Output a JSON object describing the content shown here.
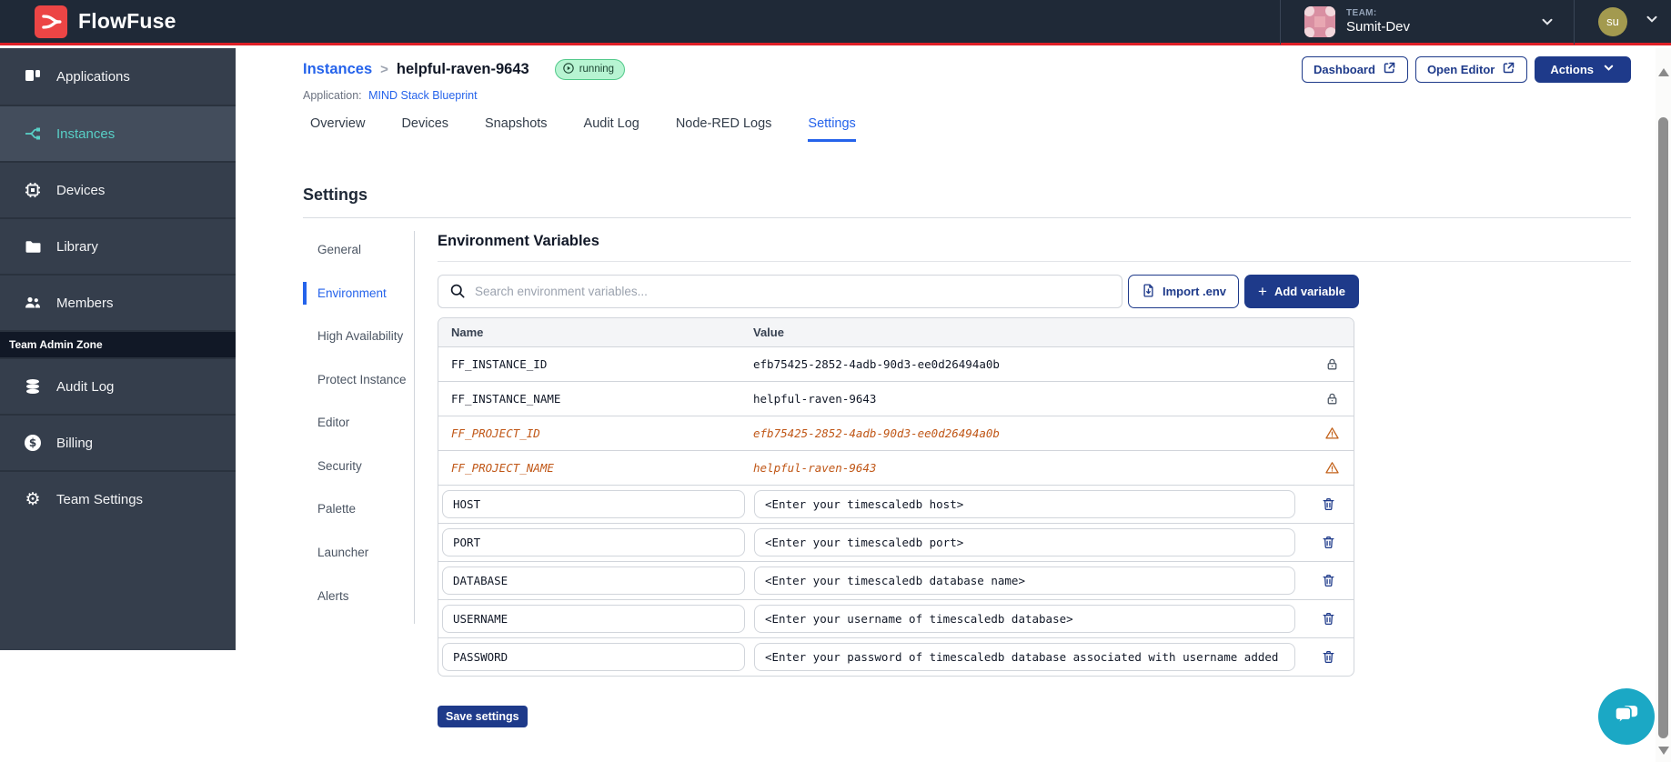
{
  "topbar": {
    "brand": "FlowFuse",
    "team": {
      "label": "TEAM:",
      "name": "Sumit-Dev"
    },
    "user": {
      "initials": "su"
    }
  },
  "sidebar": {
    "items": [
      {
        "label": "Applications"
      },
      {
        "label": "Instances"
      },
      {
        "label": "Devices"
      },
      {
        "label": "Library"
      },
      {
        "label": "Members"
      }
    ],
    "section_label": "Team Admin Zone",
    "admin_items": [
      {
        "label": "Audit Log"
      },
      {
        "label": "Billing"
      },
      {
        "label": "Team Settings"
      }
    ]
  },
  "header": {
    "breadcrumb": {
      "parent": "Instances",
      "separator": ">",
      "current": "helpful-raven-9643"
    },
    "status_badge": "running",
    "application": {
      "label": "Application:",
      "name": "MIND Stack Blueprint"
    },
    "buttons": {
      "dashboard": "Dashboard",
      "open_editor": "Open Editor",
      "actions": "Actions"
    }
  },
  "tabs": {
    "items": [
      {
        "label": "Overview"
      },
      {
        "label": "Devices"
      },
      {
        "label": "Snapshots"
      },
      {
        "label": "Audit Log"
      },
      {
        "label": "Node-RED Logs"
      },
      {
        "label": "Settings"
      }
    ],
    "active": "Settings"
  },
  "settings": {
    "title": "Settings",
    "nav": {
      "items": [
        {
          "label": "General"
        },
        {
          "label": "Environment"
        },
        {
          "label": "High Availability"
        },
        {
          "label": "Protect Instance"
        },
        {
          "label": "Editor"
        },
        {
          "label": "Security"
        },
        {
          "label": "Palette"
        },
        {
          "label": "Launcher"
        },
        {
          "label": "Alerts"
        }
      ],
      "active": "Environment"
    }
  },
  "environment": {
    "title": "Environment Variables",
    "search_placeholder": "Search environment variables...",
    "import_button": "Import .env",
    "add_button": "Add variable",
    "table": {
      "columns": {
        "name": "Name",
        "value": "Value"
      },
      "locked_rows": [
        {
          "name": "FF_INSTANCE_ID",
          "value": "efb75425-2852-4adb-90d3-ee0d26494a0b",
          "state": "locked"
        },
        {
          "name": "FF_INSTANCE_NAME",
          "value": "helpful-raven-9643",
          "state": "locked"
        },
        {
          "name": "FF_PROJECT_ID",
          "value": "efb75425-2852-4adb-90d3-ee0d26494a0b",
          "state": "warning"
        },
        {
          "name": "FF_PROJECT_NAME",
          "value": "helpful-raven-9643",
          "state": "warning"
        }
      ],
      "editable_rows": [
        {
          "name": "HOST",
          "value": "<Enter your timescaledb host>"
        },
        {
          "name": "PORT",
          "value": "<Enter your timescaledb port>"
        },
        {
          "name": "DATABASE",
          "value": "<Enter your timescaledb database name>"
        },
        {
          "name": "USERNAME",
          "value": "<Enter your username of timescaledb database>"
        },
        {
          "name": "PASSWORD",
          "value": "<Enter your password of timescaledb database associated with username added"
        }
      ]
    },
    "save_button": "Save settings"
  },
  "colors": {
    "topbar_bg": "#1F2937",
    "accent_red": "#DF1F26",
    "brand_red": "#EC4545",
    "navy": "#1E3A8A",
    "link_blue": "#2563EB",
    "sidebar_bg": "#353E4C",
    "teal_active": "#58CFC6",
    "badge_green_bg": "#B7F4D2",
    "warning_orange": "#C05717",
    "chat_teal": "#1BA8C5"
  }
}
